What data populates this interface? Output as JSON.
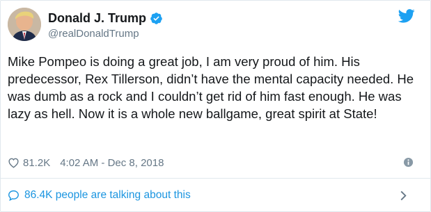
{
  "author": {
    "display_name": "Donald J. Trump",
    "handle": "@realDonaldTrump",
    "verified": true
  },
  "icons": {
    "verified": "verified-badge-icon",
    "brand": "twitter-bird-icon",
    "like": "heart-icon",
    "info": "info-icon",
    "conversation": "speech-bubble-icon",
    "expand": "chevron-right-icon"
  },
  "tweet": {
    "text": "Mike Pompeo is doing a great job, I am very proud of him. His predecessor, Rex Tillerson, didn’t have the mental capacity needed. He was dumb as a rock and I couldn’t get rid of him fast enough. He was lazy as hell. Now it is a whole new ballgame, great spirit at State!",
    "likes": "81.2K",
    "timestamp": "4:02 AM - Dec 8, 2018"
  },
  "footer": {
    "conversation_text": "86.4K people are talking about this"
  },
  "colors": {
    "brand_blue": "#1da1f2",
    "link_blue": "#1b95e0",
    "text_primary": "#14171a",
    "text_secondary": "#657786",
    "border": "#e1e8ed"
  }
}
